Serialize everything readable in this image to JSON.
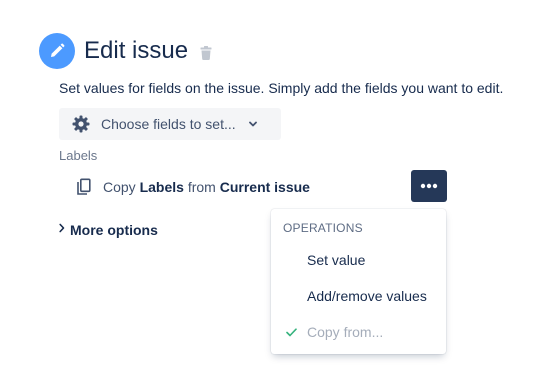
{
  "header": {
    "title": "Edit issue"
  },
  "description": "Set values for fields on the issue. Simply add the fields you want to edit.",
  "fields_button": {
    "label": "Choose fields to set..."
  },
  "field": {
    "label": "Labels",
    "copy_prefix": "Copy",
    "field_name": "Labels",
    "copy_middle": "from",
    "source": "Current issue"
  },
  "more_options": {
    "label": "More options"
  },
  "operations_menu": {
    "heading": "OPERATIONS",
    "items": [
      {
        "label": "Set value",
        "selected": false,
        "disabled": false
      },
      {
        "label": "Add/remove values",
        "selected": false,
        "disabled": false
      },
      {
        "label": "Copy from...",
        "selected": true,
        "disabled": true
      }
    ]
  },
  "colors": {
    "accent": "#4c9aff",
    "dark_button": "#253858",
    "check": "#36b37e"
  }
}
